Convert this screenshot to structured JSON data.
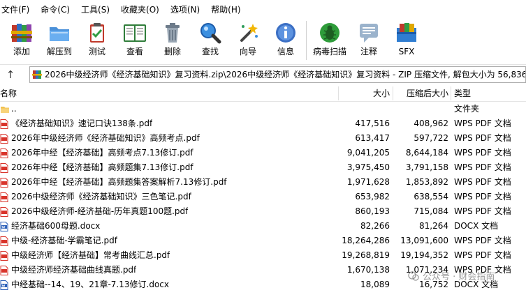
{
  "menu": [
    "文件(F)",
    "命令(C)",
    "工具(S)",
    "收藏夹(O)",
    "选项(N)",
    "帮助(H)"
  ],
  "toolbar": {
    "add": "添加",
    "extract": "解压到",
    "test": "测试",
    "view": "查看",
    "delete": "删除",
    "find": "查找",
    "wizard": "向导",
    "info": "信息",
    "virus_scan": "病毒扫描",
    "comment": "注释",
    "sfx": "SFX"
  },
  "address": {
    "path": "2026中级经济师《经济基础知识》复习资料.zip\\2026中级经济师《经济基础知识》复习资料 - ZIP 压缩文件, 解包大小为 56,836,"
  },
  "columns": {
    "name": "名称",
    "size": "大小",
    "packed": "压缩后大小",
    "type": "类型"
  },
  "files": [
    {
      "name": "..",
      "size": "",
      "packed": "",
      "type": "文件夹",
      "icon": "folder-icon"
    },
    {
      "name": "《经济基础知识》速记口诀138条.pdf",
      "size": "417,516",
      "packed": "408,962",
      "type": "WPS PDF 文档",
      "icon": "pdf-file-icon"
    },
    {
      "name": "2026年中级经济师《经济基础知识》高频考点.pdf",
      "size": "613,417",
      "packed": "597,722",
      "type": "WPS PDF 文档",
      "icon": "pdf-file-icon"
    },
    {
      "name": "2026年中经【经济基础】高频考点7.13修订.pdf",
      "size": "9,041,205",
      "packed": "8,644,184",
      "type": "WPS PDF 文档",
      "icon": "pdf-file-icon"
    },
    {
      "name": "2026年中经【经济基础】高频题集7.13修订.pdf",
      "size": "3,975,450",
      "packed": "3,791,158",
      "type": "WPS PDF 文档",
      "icon": "pdf-file-icon"
    },
    {
      "name": "2026年中经【经济基础】高频题集答案解析7.13修订.pdf",
      "size": "1,971,628",
      "packed": "1,853,892",
      "type": "WPS PDF 文档",
      "icon": "pdf-file-icon"
    },
    {
      "name": "2026中级经济师《经济基础知识》三色笔记.pdf",
      "size": "653,982",
      "packed": "638,554",
      "type": "WPS PDF 文档",
      "icon": "pdf-file-icon"
    },
    {
      "name": "2026中级经济师-经济基础-历年真题100题.pdf",
      "size": "860,193",
      "packed": "715,084",
      "type": "WPS PDF 文档",
      "icon": "pdf-file-icon"
    },
    {
      "name": "经济基础600母题.docx",
      "size": "82,266",
      "packed": "81,264",
      "type": "DOCX 文档",
      "icon": "docx-file-icon"
    },
    {
      "name": "中级-经济基础-学霸笔记.pdf",
      "size": "18,264,286",
      "packed": "13,091,600",
      "type": "WPS PDF 文档",
      "icon": "pdf-file-icon"
    },
    {
      "name": "中级经济师【经济基础】常考曲线汇总.pdf",
      "size": "19,268,819",
      "packed": "19,194,352",
      "type": "WPS PDF 文档",
      "icon": "pdf-file-icon"
    },
    {
      "name": "中级经济师经济基础曲线真题.pdf",
      "size": "1,670,138",
      "packed": "1,071,234",
      "type": "WPS PDF 文档",
      "icon": "pdf-file-icon"
    },
    {
      "name": "中经基础--14、19、21章-7.13修订.docx",
      "size": "18,089",
      "packed": "16,752",
      "type": "DOCX 文档",
      "icon": "docx-file-icon"
    }
  ],
  "watermark": "公众号 · 财会指南",
  "colors": {
    "pdf_red": "#d9342b",
    "docx_blue": "#2b5fb8",
    "folder_yellow": "#f2c14e"
  }
}
